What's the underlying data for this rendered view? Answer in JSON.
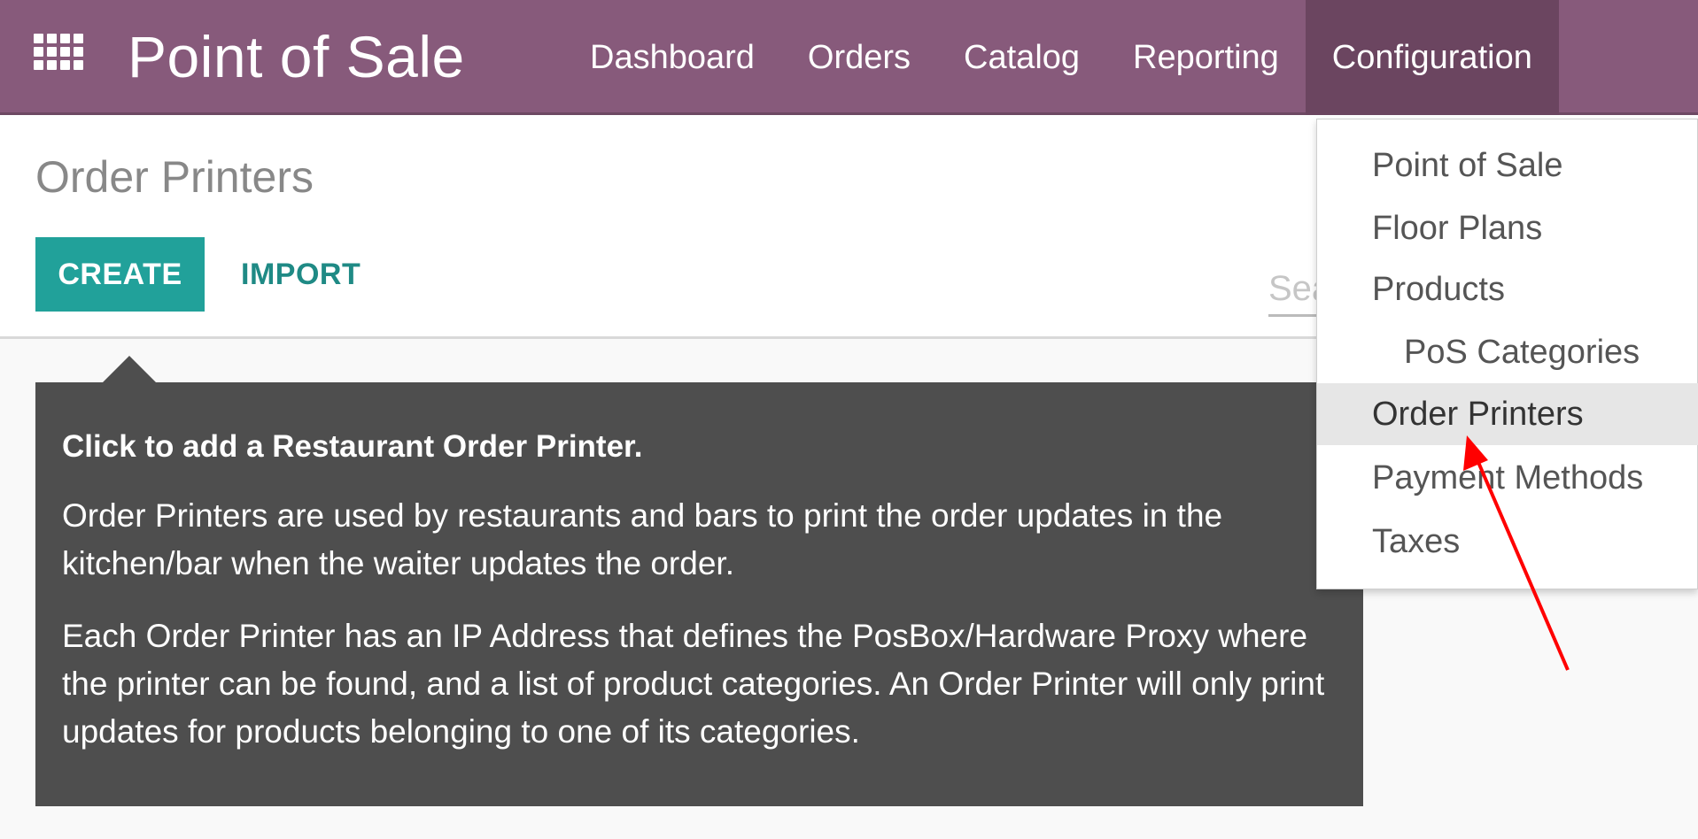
{
  "navbar": {
    "apps_icon": "apps-grid-icon",
    "brand": "Point of Sale",
    "menu": [
      "Dashboard",
      "Orders",
      "Catalog",
      "Reporting",
      "Configuration"
    ],
    "active": "Configuration",
    "color": "#875a7b"
  },
  "control_panel": {
    "title": "Order Printers",
    "create_label": "CREATE",
    "import_label": "IMPORT",
    "search_placeholder": "Search..."
  },
  "help": {
    "title": "Click to add a Restaurant Order Printer.",
    "para1": "Order Printers are used by restaurants and bars to print the order updates in the kitchen/bar when the waiter updates the order.",
    "para2": "Each Order Printer has an IP Address that defines the PosBox/Hardware Proxy where the printer can be found, and a list of product categories. An Order Printer will only print updates for products belonging to one of its categories."
  },
  "dropdown": {
    "items": [
      {
        "label": "Point of Sale"
      },
      {
        "label": "Floor Plans"
      },
      {
        "label": "Products"
      },
      {
        "label": "PoS Categories"
      },
      {
        "label": "Order Printers"
      },
      {
        "label": "Payment Methods"
      },
      {
        "label": "Taxes"
      }
    ],
    "active": "Order Printers"
  },
  "colors": {
    "accent": "#21a19a",
    "annotation_arrow": "#ff0000"
  }
}
